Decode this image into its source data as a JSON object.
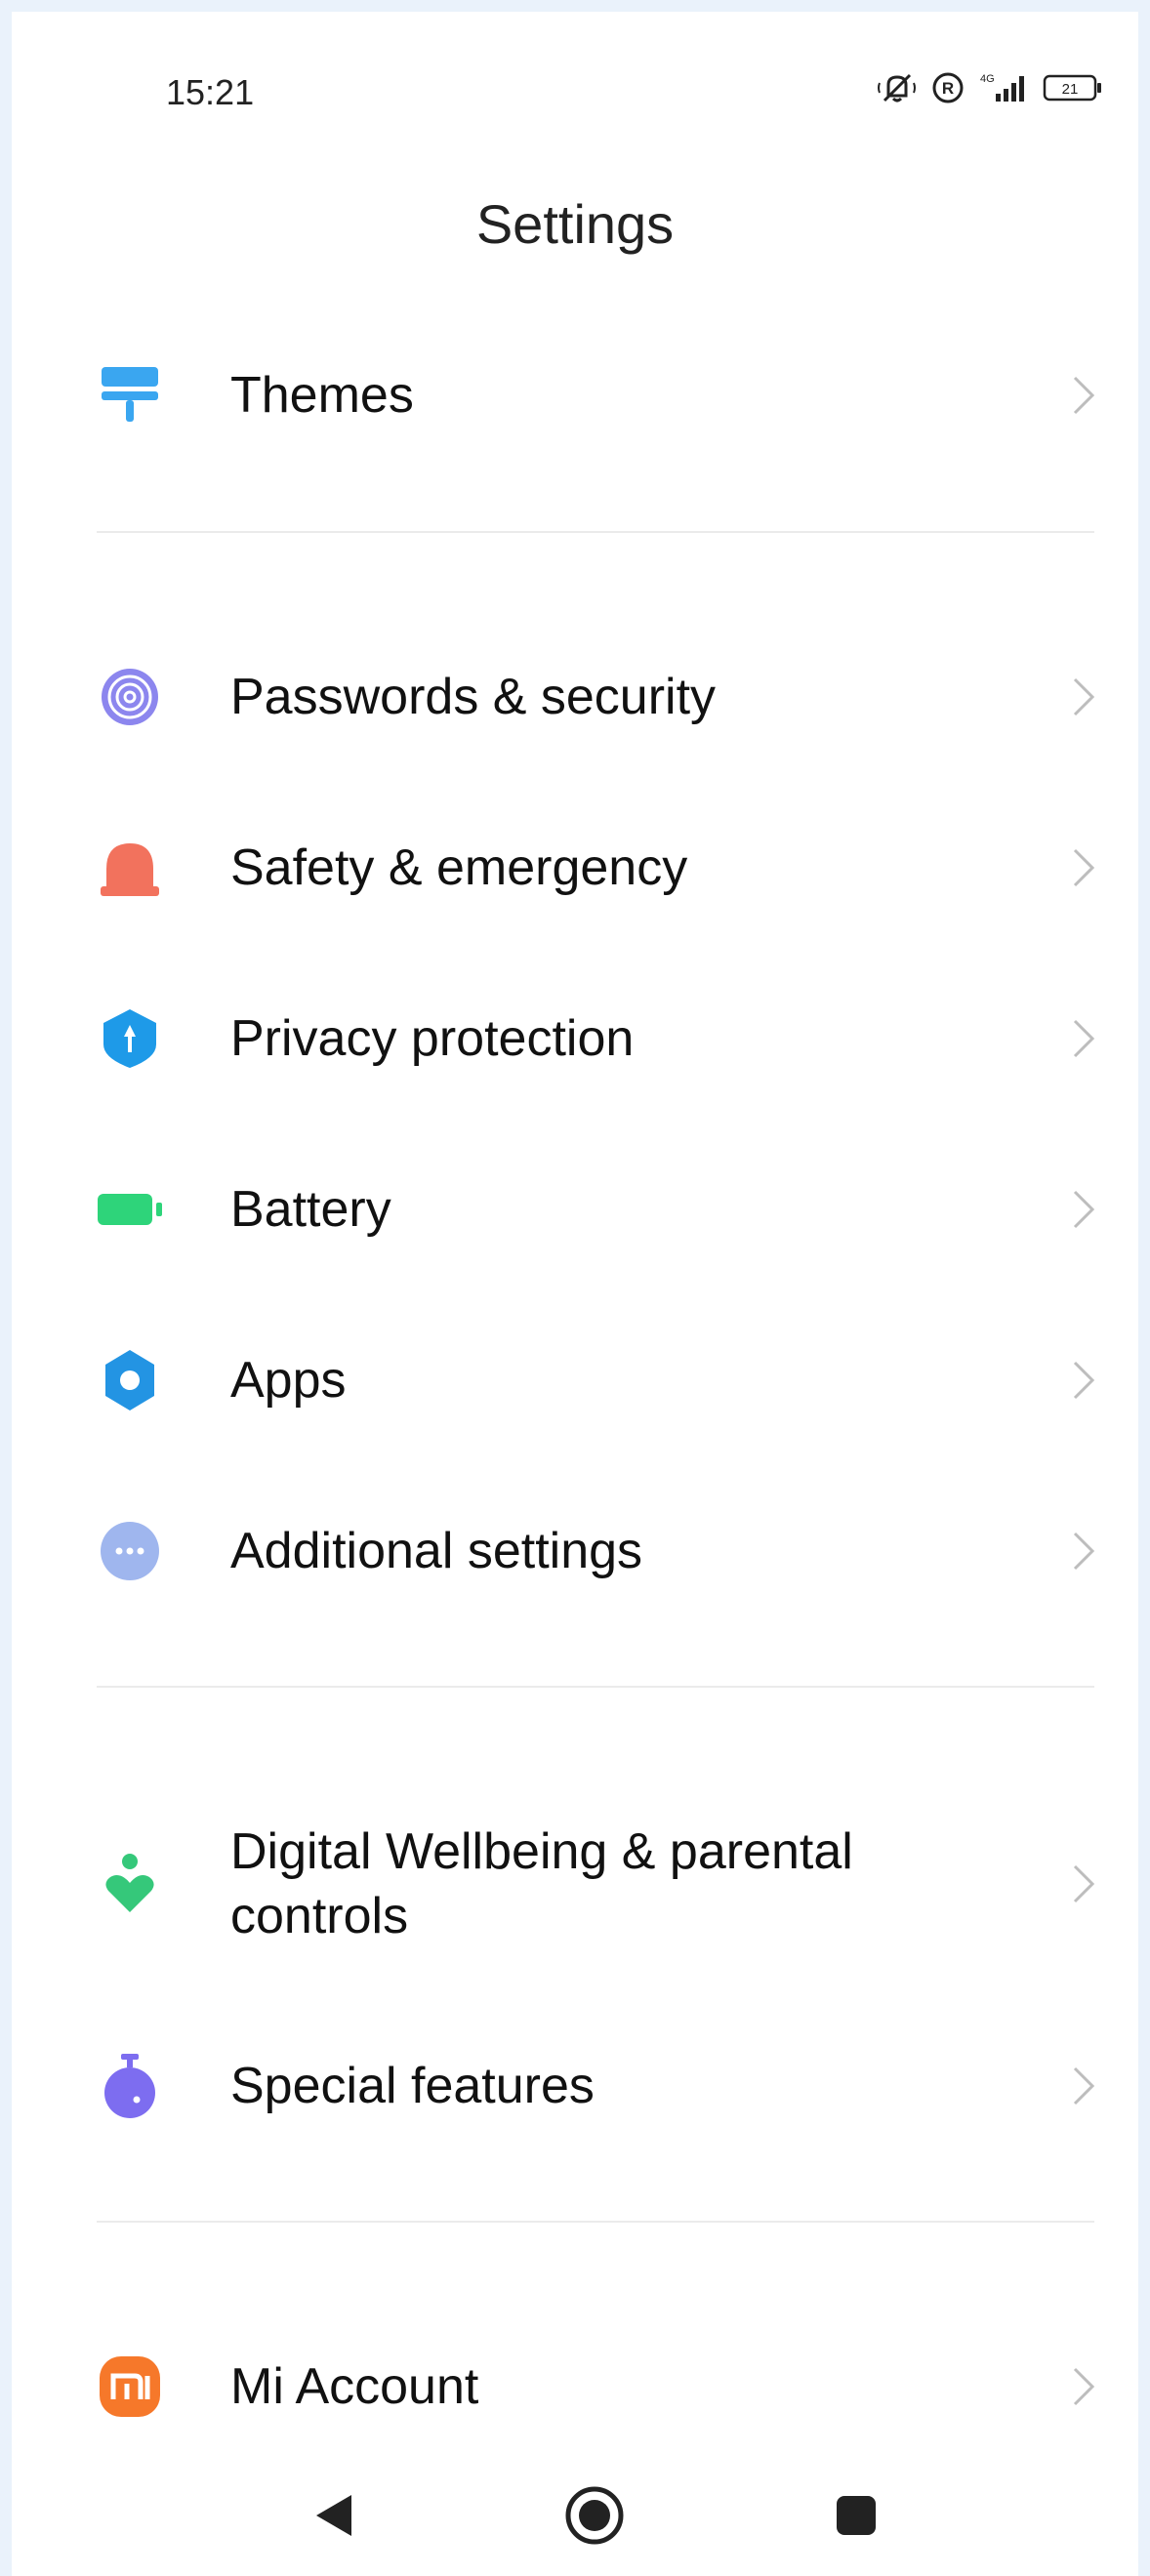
{
  "status_bar": {
    "time": "15:21",
    "network": "4G",
    "battery_level": "21",
    "icons": [
      "silent-bell-icon",
      "registered-icon",
      "signal-icon",
      "battery-icon"
    ]
  },
  "title": "Settings",
  "sections": [
    {
      "items": [
        {
          "label": "Themes",
          "icon": "paint-roller-icon",
          "icon_color": "#3aa6f0"
        }
      ]
    },
    {
      "items": [
        {
          "label": "Passwords & security",
          "icon": "fingerprint-icon",
          "icon_color": "#8c86ee"
        },
        {
          "label": "Safety & emergency",
          "icon": "alarm-light-icon",
          "icon_color": "#f2725d"
        },
        {
          "label": "Privacy protection",
          "icon": "shield-icon",
          "icon_color": "#1e9ae8"
        },
        {
          "label": "Battery",
          "icon": "battery-icon",
          "icon_color": "#2ed47a"
        },
        {
          "label": "Apps",
          "icon": "gear-icon",
          "icon_color": "#2394e3"
        },
        {
          "label": "Additional settings",
          "icon": "more-dots-icon",
          "icon_color": "#9fb6ee"
        }
      ]
    },
    {
      "items": [
        {
          "label_line1": "Digital Wellbeing & parental",
          "label_line2": "controls",
          "icon": "wellbeing-heart-icon",
          "icon_color": "#35c87a"
        },
        {
          "label": "Special features",
          "icon": "stopwatch-icon",
          "icon_color": "#7d6df0"
        }
      ]
    },
    {
      "items": [
        {
          "label": "Mi Account",
          "icon": "mi-logo-icon",
          "icon_color": "#f6782a"
        }
      ]
    }
  ],
  "nav_bar": {
    "buttons": [
      "back-icon",
      "home-icon",
      "recents-icon"
    ]
  }
}
